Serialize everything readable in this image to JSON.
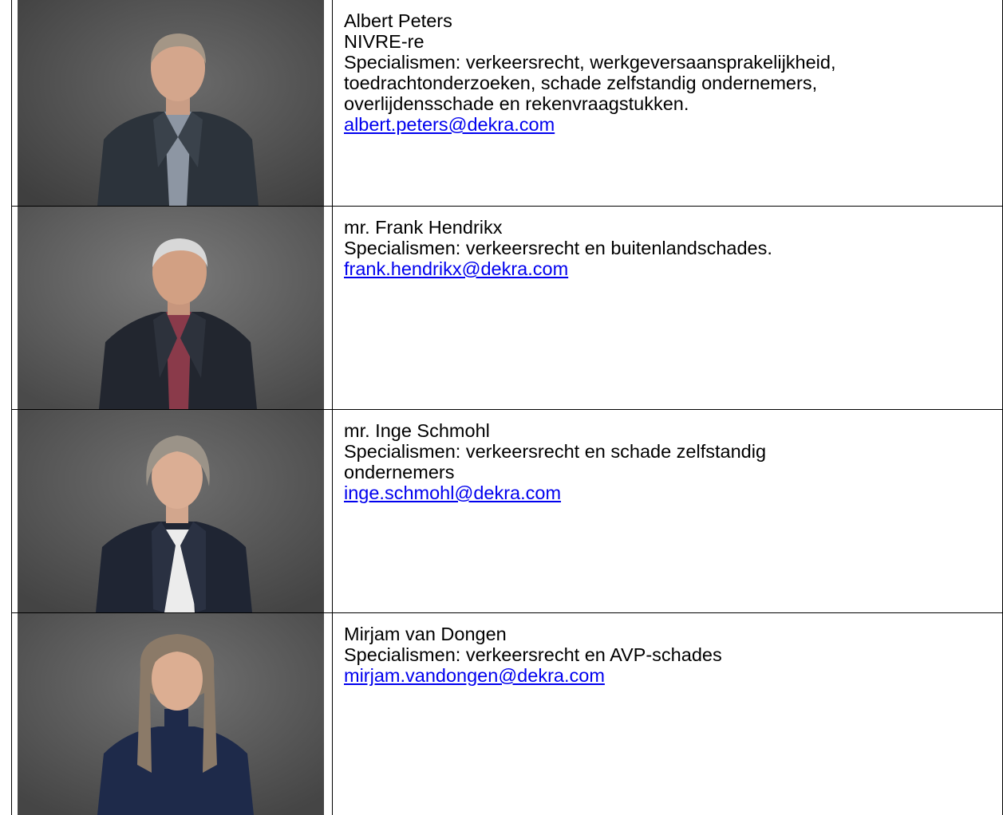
{
  "people": [
    {
      "name": "Albert Peters",
      "title": "NIVRE-re",
      "specialisms_lines": [
        "Specialismen: verkeersrecht, werkgeversaansprakelijkheid,",
        "toedrachtonderzoeken, schade zelfstandig ondernemers,",
        "overlijdensschade en rekenvraagstukken."
      ],
      "email": "albert.peters@dekra.com"
    },
    {
      "name": "mr. Frank Hendrikx",
      "specialisms_lines": [
        "Specialismen: verkeersrecht en buitenlandschades."
      ],
      "email": "frank.hendrikx@dekra.com"
    },
    {
      "name": "mr. Inge Schmohl",
      "specialisms_lines": [
        "Specialismen: verkeersrecht en schade zelfstandig",
        "ondernemers"
      ],
      "email": "inge.schmohl@dekra.com"
    },
    {
      "name": "Mirjam van Dongen",
      "specialisms_lines": [
        "Specialismen: verkeersrecht en AVP-schades"
      ],
      "email": "mirjam.vandongen@dekra.com"
    }
  ],
  "colors": {
    "link": "#0000ee",
    "photo_background": "#5b5b5b",
    "border": "#000000"
  }
}
